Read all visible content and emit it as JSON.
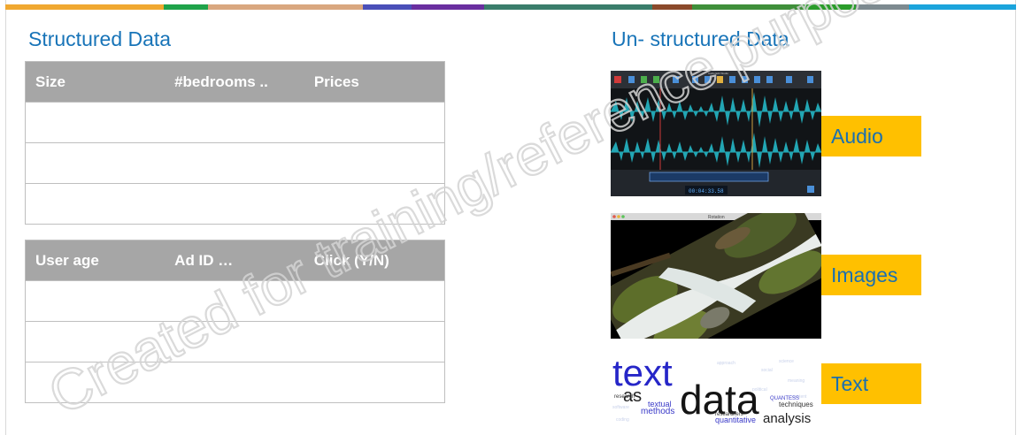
{
  "topbar_colors": [
    "#f0a830",
    "#1fa34a",
    "#d9a77f",
    "#4a4fb8",
    "#6a2fa0",
    "#3a7d6b",
    "#8b4a2b",
    "#3f8f3a",
    "#2a9c2a",
    "#7d8a90",
    "#1ba4dc"
  ],
  "structured": {
    "title": "Structured Data",
    "table1": {
      "headers": [
        "Size",
        "#bedrooms ..",
        "Prices"
      ]
    },
    "table2": {
      "headers": [
        "User age",
        "Ad ID …",
        "Click (Y/N)"
      ]
    }
  },
  "unstructured": {
    "title": "Un- structured Data",
    "items": [
      {
        "label": "Audio"
      },
      {
        "label": "Images"
      },
      {
        "label": "Text"
      }
    ],
    "audio_app": {
      "title": "Audio Edit Studio",
      "time_readout": "00:04:33.58"
    },
    "image_app": {
      "title": "Rotation"
    },
    "wordcloud": {
      "big1": "text",
      "big2": "data",
      "w_as": "as",
      "w_textual": "textual",
      "w_methods": "methods",
      "w_analysis": "analysis",
      "w_quantitative": "quantitative",
      "w_techniques": "techniques",
      "w_quantess": "QUANTESS",
      "w_research": "research",
      "w_researchers": "researchers"
    }
  },
  "watermark": "Created for training/reference purposes"
}
